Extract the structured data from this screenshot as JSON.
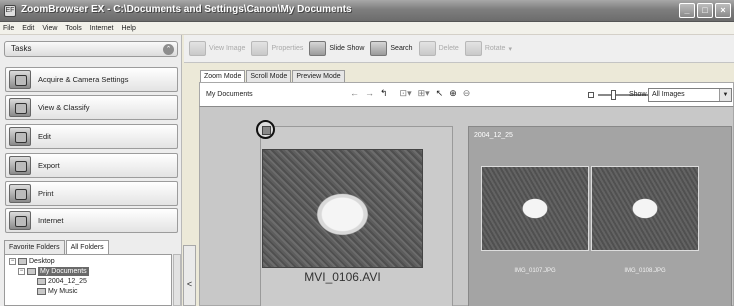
{
  "window": {
    "title": "ZoomBrowser EX  -  C:\\Documents and Settings\\Canon\\My Documents",
    "app_icon": "EF",
    "buttons": [
      "_",
      "□",
      "×"
    ]
  },
  "menu": [
    "File",
    "Edit",
    "View",
    "Tools",
    "Internet",
    "Help"
  ],
  "tasks": {
    "header": "Tasks",
    "items": [
      {
        "label": "Acquire & Camera Settings",
        "icon": "camera-icon"
      },
      {
        "label": "View & Classify",
        "icon": "view-classify-icon"
      },
      {
        "label": "Edit",
        "icon": "edit-icon"
      },
      {
        "label": "Export",
        "icon": "export-icon"
      },
      {
        "label": "Print",
        "icon": "printer-icon"
      },
      {
        "label": "Internet",
        "icon": "globe-icon"
      }
    ]
  },
  "folders": {
    "tabs": [
      "Favorite Folders",
      "All Folders"
    ],
    "active_tab": "All Folders",
    "tree": [
      {
        "label": "Desktop",
        "expander": "−"
      },
      {
        "label": "My Documents",
        "expander": "−",
        "selected": true
      },
      {
        "label": "2004_12_25"
      },
      {
        "label": "My Music"
      }
    ],
    "collapse_glyph": "<"
  },
  "toolbar": {
    "items": [
      {
        "label": "View Image",
        "enabled": false
      },
      {
        "label": "Properties",
        "enabled": false
      },
      {
        "label": "Slide Show",
        "enabled": true
      },
      {
        "label": "Search",
        "enabled": true
      },
      {
        "label": "Delete",
        "enabled": false
      },
      {
        "label": "Rotate",
        "enabled": false
      }
    ]
  },
  "view": {
    "tabs": [
      "Zoom Mode",
      "Scroll Mode",
      "Preview Mode"
    ],
    "active_tab": "Zoom Mode",
    "breadcrumb": "My Documents",
    "show_label": "Show",
    "show_value": "All Images",
    "zoom_level": 0.15
  },
  "content": {
    "main_item": {
      "caption": "MVI_0106.AVI",
      "type": "movie"
    },
    "group": {
      "label": "2004_12_25",
      "items": [
        {
          "caption": "IMG_0107.JPG"
        },
        {
          "caption": "IMG_0108.JPG"
        }
      ]
    }
  },
  "colors": {
    "titlebar": "#7e7e7e",
    "panel_bg": "#c8c8c8",
    "group_bg": "#a4a4a4"
  }
}
